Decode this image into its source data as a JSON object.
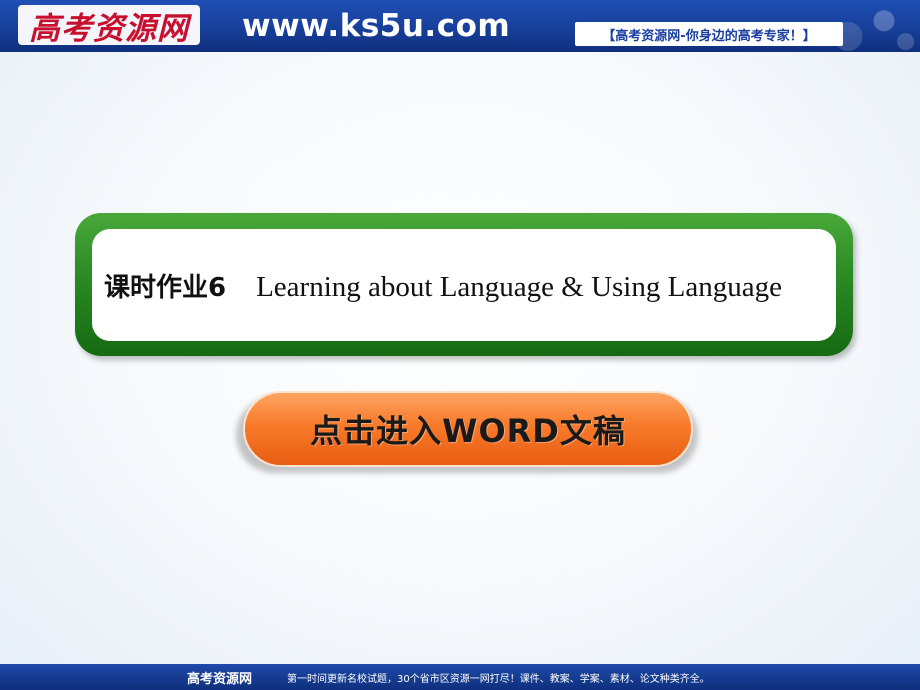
{
  "header": {
    "logo": "高考资源网",
    "url": "www.ks5u.com",
    "slogan": "【高考资源网-你身边的高考专家！】"
  },
  "title": {
    "chinese": "课时作业6",
    "english": "Learning about Language & Using Language"
  },
  "button": {
    "label": "点击进入WORD文稿"
  },
  "footer": {
    "brand": "高考资源网",
    "text": "第一时间更新名校试题，30个省市区资源一网打尽！课件、教案、学案、素材、论文种类齐全。"
  },
  "colors": {
    "header_blue": "#173f9a",
    "logo_red": "#c8102e",
    "frame_green": "#2a8a24",
    "button_orange": "#f77a2a"
  }
}
